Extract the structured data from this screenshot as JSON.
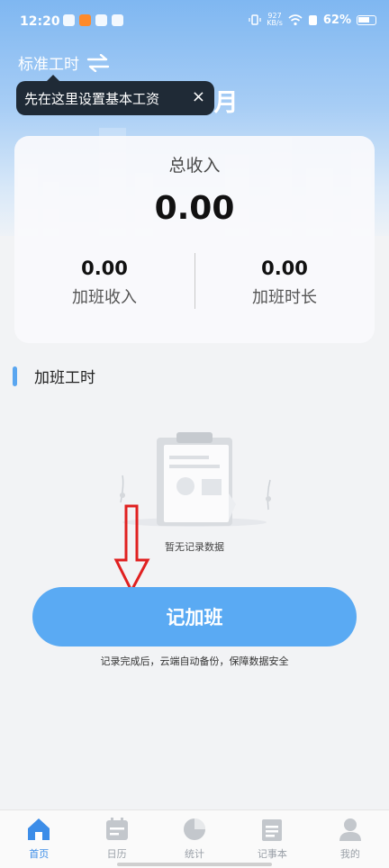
{
  "status_bar": {
    "time": "12:20",
    "net_speed_value": "927",
    "net_speed_unit": "KB/s",
    "battery": "62%"
  },
  "header": {
    "mode_label": "标准工时",
    "month": "04月"
  },
  "tooltip": {
    "text": "先在这里设置基本工资",
    "close": "×"
  },
  "summary": {
    "total_label": "总收入",
    "total_value": "0.00",
    "overtime_income_value": "0.00",
    "overtime_income_label": "加班收入",
    "overtime_hours_value": "0.00",
    "overtime_hours_label": "加班时长"
  },
  "section": {
    "title": "加班工时",
    "empty_text": "暂无记录数据"
  },
  "action": {
    "button_label": "记加班",
    "note": "记录完成后，云端自动备份，保障数据安全"
  },
  "tabs": [
    {
      "label": "首页",
      "icon": "home-icon",
      "active": true
    },
    {
      "label": "日历",
      "icon": "calendar-icon",
      "active": false
    },
    {
      "label": "统计",
      "icon": "pie-chart-icon",
      "active": false
    },
    {
      "label": "记事本",
      "icon": "notebook-icon",
      "active": false
    },
    {
      "label": "我的",
      "icon": "user-icon",
      "active": false
    }
  ],
  "colors": {
    "accent": "#5aaaf3",
    "tooltip_bg": "#1f2a36",
    "annotation_arrow": "#e02020"
  }
}
